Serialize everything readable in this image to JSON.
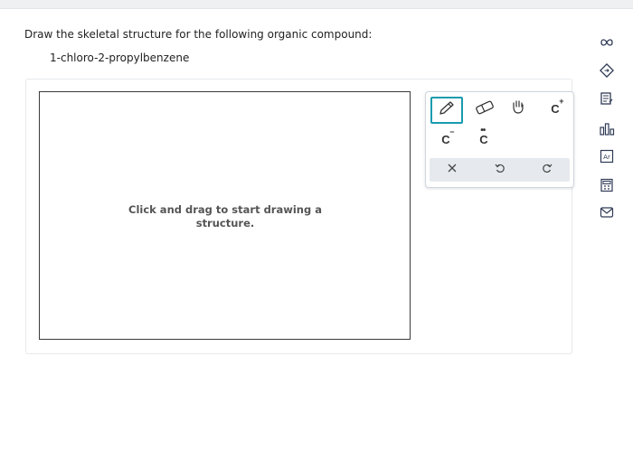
{
  "question": {
    "prompt": "Draw the skeletal structure for the following organic compound:",
    "compound": "1-chloro-2-propylbenzene"
  },
  "canvas": {
    "hint": "Click and drag to start drawing a structure."
  },
  "toolbox": {
    "tools": [
      {
        "name": "pencil",
        "icon": "pencil-icon",
        "selected": true
      },
      {
        "name": "eraser",
        "icon": "eraser-icon"
      },
      {
        "name": "hand",
        "icon": "hand-icon"
      },
      {
        "name": "carbocation",
        "label": "C",
        "charge": "+"
      },
      {
        "name": "carbanion",
        "label": "C",
        "charge": "−"
      },
      {
        "name": "lone-pair",
        "label": "C",
        "dots": "••"
      }
    ],
    "actions": [
      {
        "name": "clear",
        "icon": "x-icon"
      },
      {
        "name": "undo",
        "icon": "undo-icon"
      },
      {
        "name": "redo",
        "icon": "redo-icon"
      }
    ],
    "accent_color": "#1a9bb0"
  },
  "rail": {
    "icons": [
      "infinity-icon",
      "diamond-arrow-icon",
      "notes-icon",
      "bar-chart-icon",
      "periodic-table-icon",
      "calculator-icon",
      "mail-icon"
    ],
    "color": "#2f3a55"
  }
}
